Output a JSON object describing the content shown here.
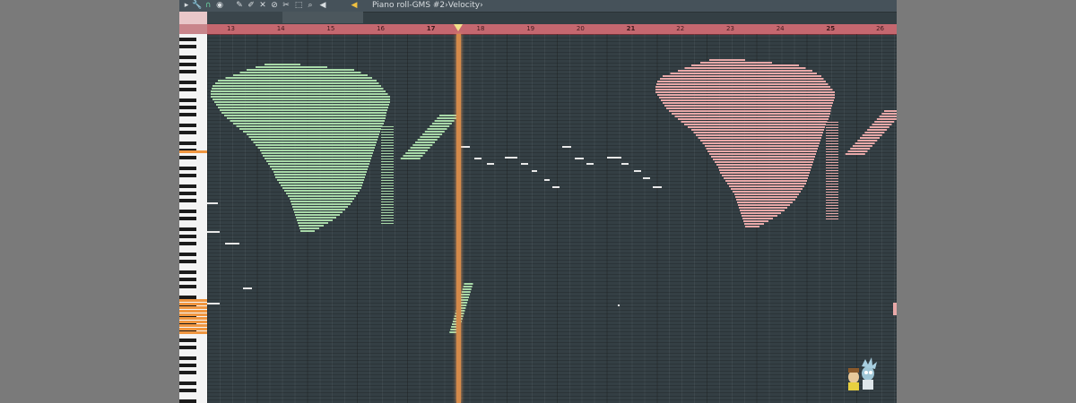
{
  "window": {
    "title_parts": [
      "Piano roll",
      "GMS #2",
      "Velocity"
    ],
    "separator1": " - ",
    "separator2": " › ",
    "separator3": " ›"
  },
  "ruler": {
    "bars": [
      "13",
      "14",
      "15",
      "16",
      "17",
      "18",
      "19",
      "20",
      "21",
      "22",
      "23",
      "24",
      "25",
      "26"
    ],
    "bold_bars": [
      "17",
      "21",
      "25"
    ]
  },
  "notes": {
    "left_map_color": "#a8d9a8",
    "right_map_color": "#e8a8a8",
    "melody_color": "#e8e8e8",
    "left_label": "AFRICA",
    "right_label": "AFRICA"
  },
  "colors": {
    "background": "#343f44",
    "ruler": "#c5676f",
    "playhead": "#d48a4a",
    "key_highlight": "#f09640"
  },
  "icons": [
    "play-arrow-icon",
    "wrench-icon",
    "magnet-icon",
    "record-icon",
    "pencil-icon",
    "brush-icon",
    "delete-icon",
    "mute-icon",
    "slice-icon",
    "select-icon",
    "zoom-icon",
    "speaker-icon"
  ]
}
